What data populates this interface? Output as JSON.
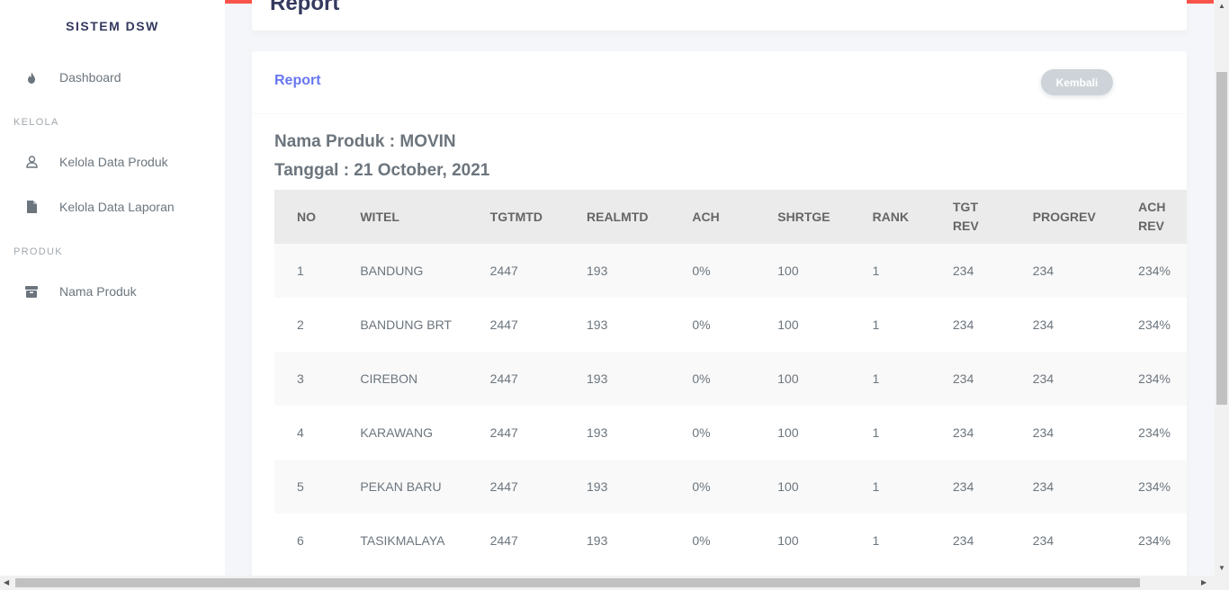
{
  "sidebar": {
    "brand": "SISTEM DSW",
    "items": [
      {
        "label": "Dashboard"
      },
      {
        "label": "Kelola Data Produk"
      },
      {
        "label": "Kelola Data Laporan"
      },
      {
        "label": "Nama Produk"
      }
    ],
    "sections": [
      "KELOLA",
      "PRODUK"
    ]
  },
  "page": {
    "title": "Report"
  },
  "card": {
    "title": "Report",
    "back_label": "Kembali",
    "product_line": "Nama Produk : MOVIN",
    "date_line": "Tanggal : 21 October, 2021"
  },
  "table": {
    "headers": [
      "NO",
      "WITEL",
      "TGTMTD",
      "REALMTD",
      "ACH",
      "SHRTGE",
      "RANK",
      "TGT REV",
      "PROGREV",
      "ACH REV"
    ],
    "rows": [
      [
        "1",
        "BANDUNG",
        "2447",
        "193",
        "0%",
        "100",
        "1",
        "234",
        "234",
        "234%"
      ],
      [
        "2",
        "BANDUNG BRT",
        "2447",
        "193",
        "0%",
        "100",
        "1",
        "234",
        "234",
        "234%"
      ],
      [
        "3",
        "CIREBON",
        "2447",
        "193",
        "0%",
        "100",
        "1",
        "234",
        "234",
        "234%"
      ],
      [
        "4",
        "KARAWANG",
        "2447",
        "193",
        "0%",
        "100",
        "1",
        "234",
        "234",
        "234%"
      ],
      [
        "5",
        "PEKAN BARU",
        "2447",
        "193",
        "0%",
        "100",
        "1",
        "234",
        "234",
        "234%"
      ],
      [
        "6",
        "TASIKMALAYA",
        "2447",
        "193",
        "0%",
        "100",
        "1",
        "234",
        "234",
        "234%"
      ]
    ]
  },
  "colors": {
    "accent": "#6777ef",
    "danger": "#fc544b",
    "back_button": "#cdd3d8"
  }
}
